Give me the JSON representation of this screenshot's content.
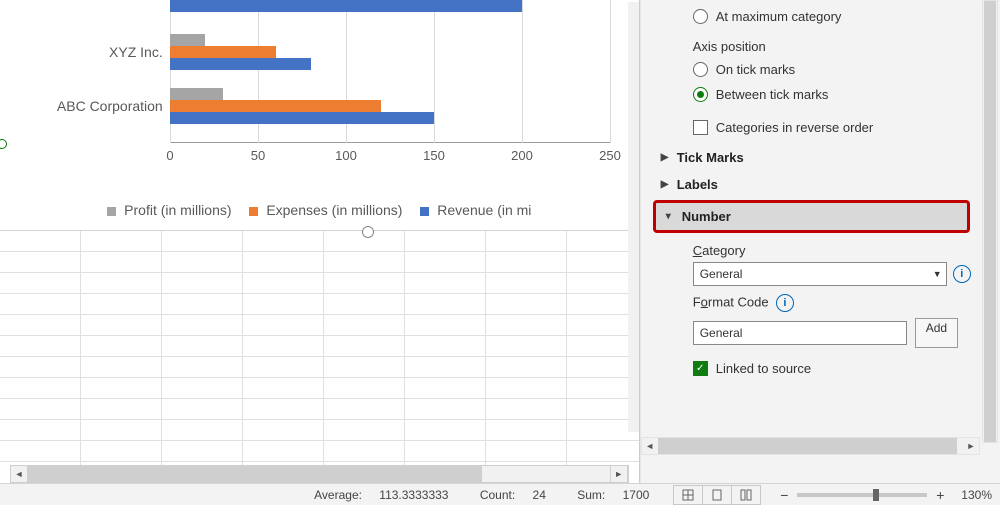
{
  "chart_data": {
    "type": "bar",
    "orientation": "horizontal",
    "categories": [
      "ABC Corporation",
      "XYZ Inc."
    ],
    "series": [
      {
        "name": "Revenue (in millions)",
        "color": "#4472c4",
        "values": [
          150,
          80
        ]
      },
      {
        "name": "Expenses (in millions)",
        "color": "#ed7d31",
        "values": [
          120,
          60
        ]
      },
      {
        "name": "Profit (in millions)",
        "color": "#a5a5a5",
        "values": [
          30,
          20
        ]
      }
    ],
    "x_ticks": [
      0,
      50,
      100,
      150,
      200,
      250
    ],
    "xlim": [
      0,
      250
    ],
    "first_bar_partially_visible": {
      "value": 200,
      "series": "Revenue (in millions)"
    }
  },
  "legend": {
    "items": [
      "Profit (in millions)",
      "Expenses (in millions)",
      "Revenue (in mi"
    ]
  },
  "pane": {
    "radio_at_max": "At maximum category",
    "axis_position_label": "Axis position",
    "radio_on_tick": "On tick marks",
    "radio_between_tick": "Between tick marks",
    "checkbox_reverse": "Categories in reverse order",
    "section_tick_marks": "Tick Marks",
    "section_labels": "Labels",
    "section_number": "Number",
    "category_label": "Category",
    "category_value": "General",
    "format_code_label": "Format Code",
    "format_code_value": "General",
    "add_button": "Add",
    "linked_to_source": "Linked to source"
  },
  "status": {
    "average_label": "Average:",
    "average_value": "113.3333333",
    "count_label": "Count:",
    "count_value": "24",
    "sum_label": "Sum:",
    "sum_value": "1700",
    "zoom_pct": "130%"
  }
}
